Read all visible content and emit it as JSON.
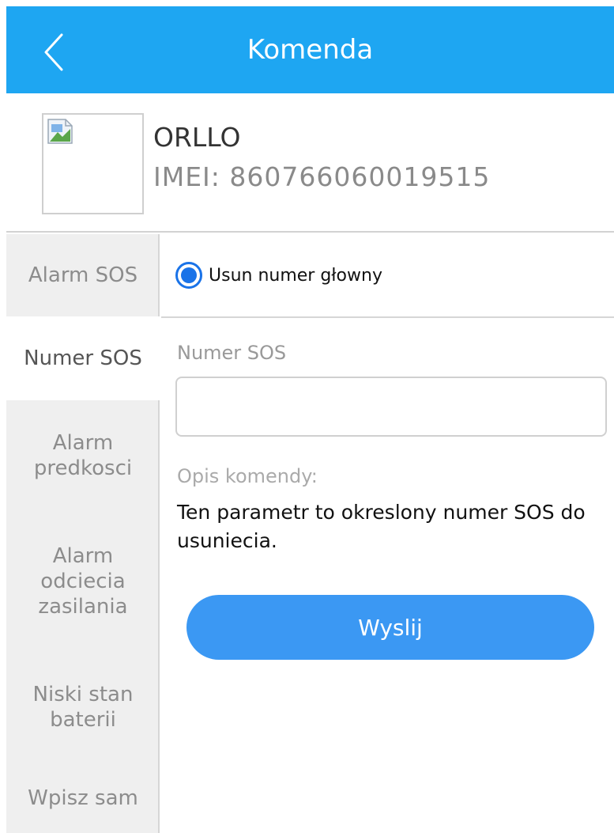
{
  "header": {
    "title": "Komenda",
    "back_icon": "chevron-left-icon",
    "bg_color": "#1ea6f2"
  },
  "device": {
    "name": "ORLLO",
    "imei": "IMEI:  860766060019515",
    "image_icon": "broken-image-icon"
  },
  "sidebar": {
    "items": [
      {
        "label": "Alarm SOS",
        "active": false
      },
      {
        "label": "Numer SOS",
        "active": true
      },
      {
        "label": "Alarm\npredkosci",
        "active": false
      },
      {
        "label": "Alarm\nodciecia\nzasilania",
        "active": false
      },
      {
        "label": "Niski stan\nbaterii",
        "active": false
      },
      {
        "label": "Wpisz sam",
        "active": false
      }
    ]
  },
  "form": {
    "radio_label": "Usun numer głowny",
    "radio_checked": true,
    "field_label": "Numer SOS",
    "field_value": "",
    "description_label": "Opis komendy:",
    "description_text": "Ten parametr to okreslony numer SOS do usuniecia.",
    "send_label": "Wyslij",
    "accent_color": "#3b98f3"
  }
}
